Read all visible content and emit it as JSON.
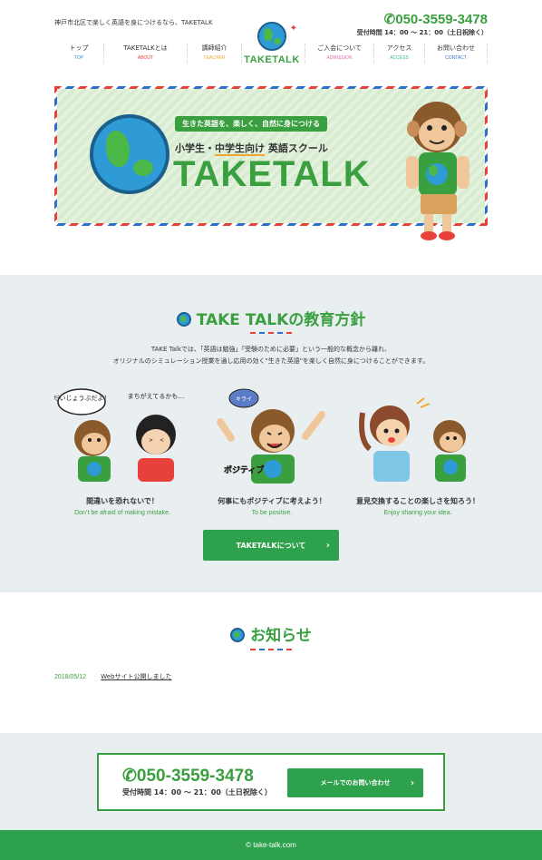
{
  "header": {
    "tagline": "神戸市北区で楽しく英語を身につけるなら、TAKETALK",
    "logo_text": "TAKETALK",
    "phone": "050-3559-3478",
    "hours": "受付時間 14：00 〜 21：00（土日祝除く）",
    "nav": [
      {
        "label": "トップ",
        "sub": "TOP",
        "color": "#3a8fd0"
      },
      {
        "label": "TAKETALKとは",
        "sub": "ABOUT",
        "color": "#e8413b"
      },
      {
        "label": "講師紹介",
        "sub": "TEACHER",
        "color": "#f3a633"
      },
      {
        "label": "ご入会について",
        "sub": "ADMISSION",
        "color": "#e06aa8"
      },
      {
        "label": "アクセス",
        "sub": "ACCESS",
        "color": "#3ab5a0"
      },
      {
        "label": "お問い合わせ",
        "sub": "CONTACT",
        "color": "#3a6fcb"
      }
    ]
  },
  "hero": {
    "catch": "生きた英語を、楽しく、自然に身につける",
    "sub_pre": "小学生・",
    "sub_mid": "中学生向け",
    "sub_post": " 英語スクール",
    "title": "TAKETALK"
  },
  "policy": {
    "title": "TAKE TALKの教育方針",
    "intro_1": "TAKE Talkでは、「英語は勉強」「受験のために必要」という一般的な概念から離れ、",
    "intro_2": "オリジナルのシミュレーション授業を通し応用の効く\"生きた英語\"を楽しく自然に身につけることができます。",
    "features": [
      {
        "jp": "間違いを恐れないで！",
        "en": "Don’t be afraid of making mistake.",
        "bubble1": "だいじょうぶだよ！",
        "bubble2": "まちがえてるかも…"
      },
      {
        "jp": "何事にもポジティブに考えよう！",
        "en": "To be positive.",
        "bubble1": "キライ",
        "bubble2": "ポジティブ"
      },
      {
        "jp": "意見交換することの楽しさを知ろう！",
        "en": "Enjoy sharing your idea.",
        "bubble1": "",
        "bubble2": ""
      }
    ],
    "button": "TAKETALKについて"
  },
  "news": {
    "title": "お知らせ",
    "items": [
      {
        "date": "2018/05/12",
        "text": "Webサイト公開しました"
      }
    ]
  },
  "contact": {
    "phone": "050-3559-3478",
    "hours": "受付時間 14：00 〜 21：00（土日祝除く）",
    "button": "メールでのお問い合わせ"
  },
  "footer": {
    "copyright": "© take-talk.com"
  },
  "icons": {
    "phone": "phone-icon",
    "chevron": "chevron-right-icon",
    "globe": "globe-icon"
  },
  "colors": {
    "brand_green": "#3a9f3f",
    "button_green": "#2ea14d",
    "section_bg": "#e9eff1"
  }
}
